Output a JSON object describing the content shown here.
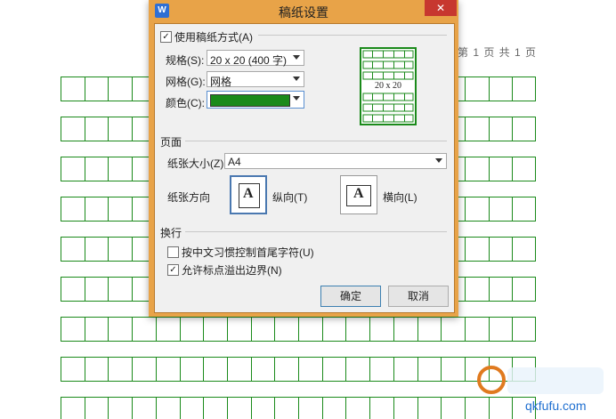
{
  "document": {
    "page_info": "第 1 页 共 1 页",
    "grid_color": "#1a8a1a",
    "watermark_text": "qkfufu.com"
  },
  "dialog": {
    "title": "稿纸设置",
    "app_icon": "W",
    "close_label": "✕",
    "use_manuscript": {
      "label": "使用稿纸方式(A)",
      "checked": true
    },
    "spec": {
      "label": "规格(S):",
      "value": "20 x 20 (400 字)"
    },
    "grid": {
      "label": "网格(G):",
      "value": "网格"
    },
    "color": {
      "label": "颜色(C):",
      "value": "#1a8a1a"
    },
    "preview_label": "20 x 20",
    "page_section": {
      "title": "页面",
      "paper_size": {
        "label": "纸张大小(Z):",
        "value": "A4"
      },
      "orientation_label": "纸张方向",
      "portrait_label": "纵向(T)",
      "landscape_label": "横向(L)",
      "selected": "portrait"
    },
    "wrap_section": {
      "title": "换行",
      "option1": {
        "label": "按中文习惯控制首尾字符(U)",
        "checked": false
      },
      "option2": {
        "label": "允许标点溢出边界(N)",
        "checked": true
      }
    },
    "ok_label": "确定",
    "cancel_label": "取消"
  }
}
